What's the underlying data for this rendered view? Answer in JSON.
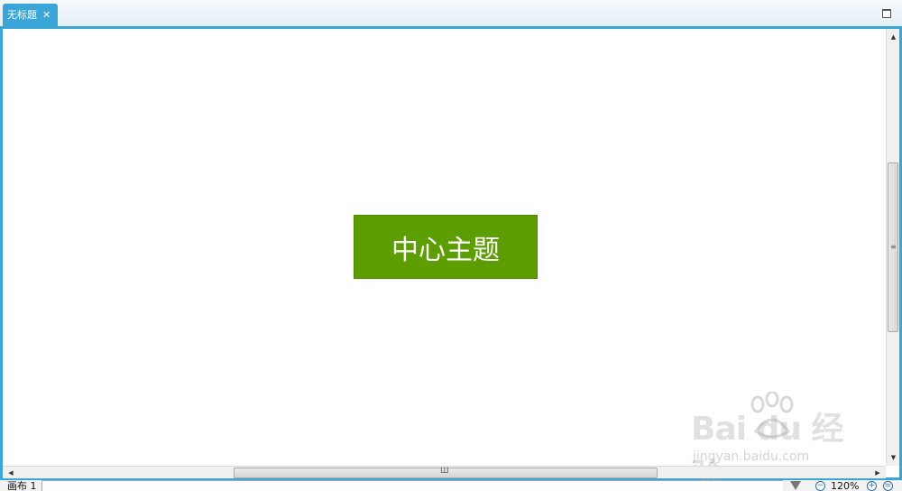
{
  "tab": {
    "title": "无标题",
    "close_label": "✕"
  },
  "canvas": {
    "central_topic": "中心主题",
    "topic_color": "#5c9e00"
  },
  "scrollbars": {
    "up": "▲",
    "down": "▼",
    "left": "◀",
    "right": "▶",
    "vgrip": "≡",
    "hgrip": "Ш"
  },
  "status_bar": {
    "sheet_label": "画布 1",
    "zoom_level": "120%",
    "zoom_out": "−",
    "zoom_in": "+",
    "zoom_fit": "="
  },
  "watermark": {
    "brand": "Bai du 经验",
    "url": "jingyan.baidu.com"
  },
  "colors": {
    "accent": "#3aa6d8",
    "topic": "#5c9e00"
  }
}
